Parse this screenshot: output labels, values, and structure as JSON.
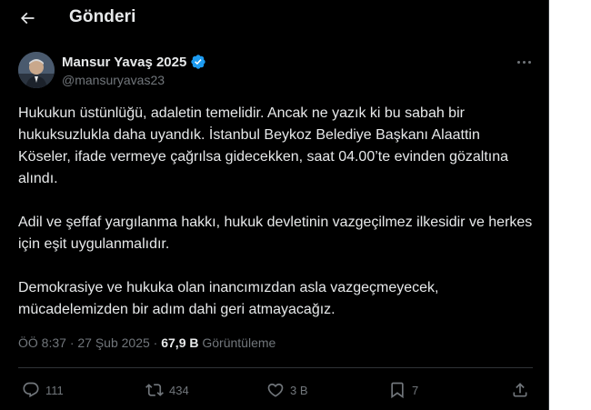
{
  "header": {
    "title": "Gönderi"
  },
  "author": {
    "name": "Mansur Yavaş 2025",
    "handle": "@mansuryavas23",
    "verified_color": "#1d9bf0"
  },
  "tweet": {
    "paragraphs": [
      "Hukukun üstünlüğü, adaletin temelidir. Ancak ne yazık ki bu sabah bir hukuksuzlukla daha uyandık. İstanbul Beykoz Belediye Başkanı Alaattin Köseler, ifade vermeye çağrılsa gidecekken, saat 04.00’te evinden gözaltına alındı.",
      "Adil ve şeffaf yargılanma hakkı, hukuk devletinin vazgeçilmez ilkesidir ve herkes için eşit uygulanmalıdır.",
      "Demokrasiye ve hukuka olan inancımızdan asla vazgeçmeyecek, mücadelemizden bir adım dahi geri atmayacağız."
    ],
    "time": "ÖÖ 8:37",
    "separator": "·",
    "date": "27 Şub 2025",
    "views_count": "67,9 B",
    "views_label": "Görüntüleme"
  },
  "actions": {
    "replies": "111",
    "retweets": "434",
    "likes": "3 B",
    "bookmarks": "7"
  },
  "icons": {
    "back": "arrow-left-icon",
    "more": "more-horizontal-icon",
    "reply": "reply-icon",
    "retweet": "retweet-icon",
    "like": "heart-icon",
    "bookmark": "bookmark-icon",
    "share": "share-icon"
  },
  "colors": {
    "background": "#000000",
    "text": "#e7e9ea",
    "muted": "#71767b",
    "divider": "#2f3336"
  }
}
